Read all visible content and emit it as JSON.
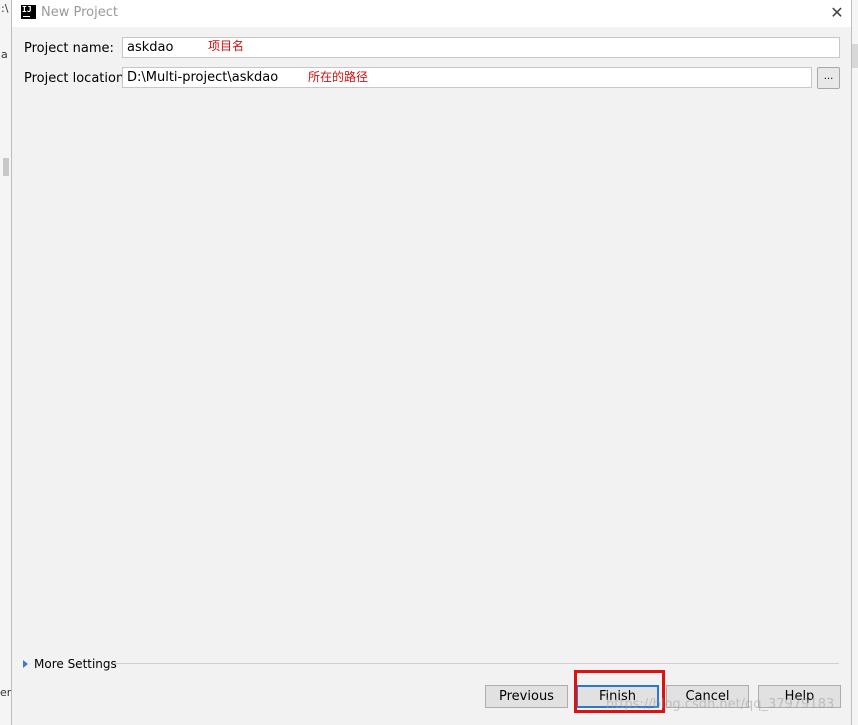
{
  "window": {
    "title": "New Project",
    "close_icon": "close-icon"
  },
  "form": {
    "project_name_label": "Project name:",
    "project_name_value": "askdao",
    "project_name_annotation": "项目名",
    "project_location_label": "Project location:",
    "project_location_value": "D:\\Multi-project\\askdao",
    "project_location_annotation": "所在的路径",
    "browse_label": "..."
  },
  "more_settings": {
    "label": "More Settings"
  },
  "buttons": {
    "previous": "Previous",
    "finish": "Finish",
    "cancel": "Cancel",
    "help": "Help"
  },
  "background_fragments": {
    "left_top": ":\\",
    "left_mid": "a",
    "left_bottom": "er"
  },
  "watermark": "https://blog.csdn.net/qq_37979183",
  "colors": {
    "annotation": "#d01010",
    "focus": "#2b77d4",
    "highlight": "#e01010"
  }
}
